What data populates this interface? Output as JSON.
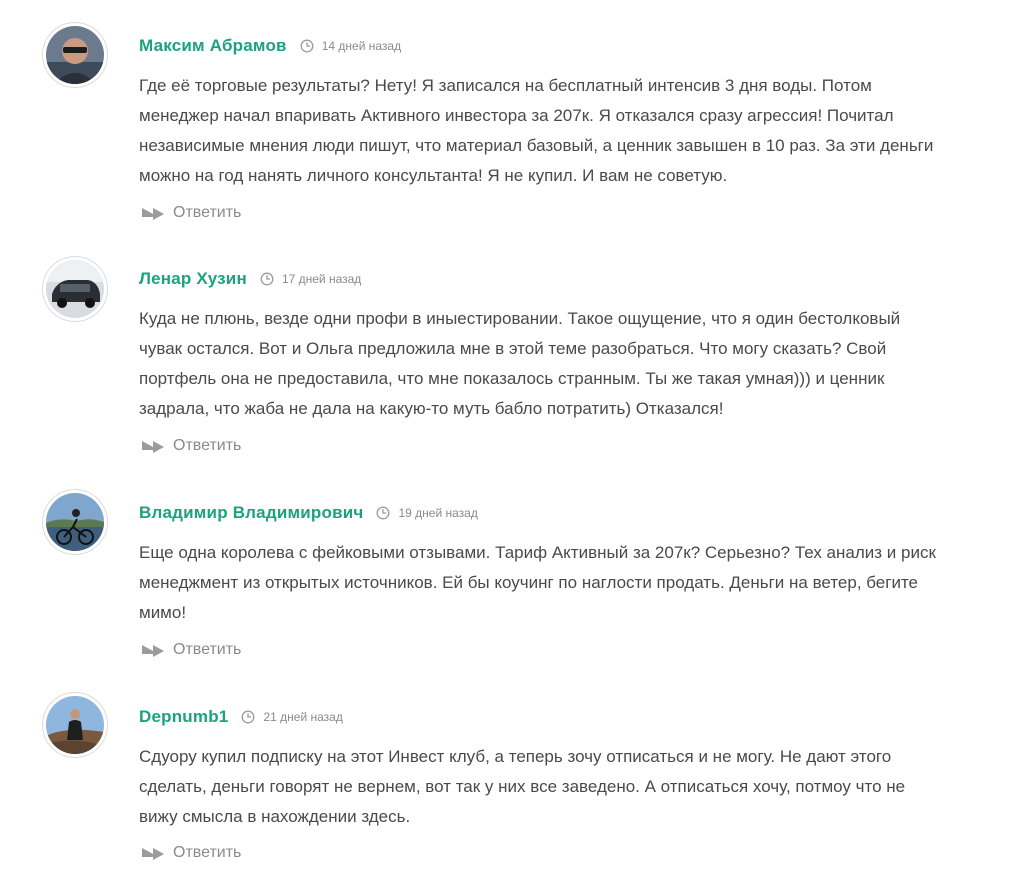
{
  "comments": [
    {
      "author": "Максим Абрамов",
      "time": "14 дней назад",
      "lines": [
        "Где её торговые результаты? Нету! Я записался на бесплатный интенсив 3 дня воды. Потом",
        "менеджер начал впаривать Активного инвестора за 207к. Я отказался сразу агрессия! Почитал",
        "независимые мнения люди пишут, что материал базовый, а ценник завышен в 10 раз. За эти деньги",
        "можно на год нанять личного консультанта! Я не купил. И вам не советую."
      ],
      "reply_label": "Ответить"
    },
    {
      "author": "Ленар Хузин",
      "time": "17 дней назад",
      "lines": [
        "Куда не плюнь, везде одни профи в иныестировании. Такое ощущение, что я один бестолковый",
        "чувак остался. Вот и Ольга предложила мне в этой теме разобраться. Что могу сказать? Свой",
        "портфель она не предоставила, что мне показалось странным. Ты же такая умная))) и ценник",
        "задрала, что жаба не дала на какую-то муть бабло потратить) Отказался!"
      ],
      "reply_label": "Ответить"
    },
    {
      "author": "Владимир Владимирович",
      "time": "19 дней назад",
      "lines": [
        "Еще одна королева с фейковыми отзывами. Тариф Активный за 207к? Серьезно? Тех анализ и риск",
        "менеджмент из открытых источников. Ей бы коучинг по наглости продать. Деньги на ветер, бегите",
        "мимо!"
      ],
      "reply_label": "Ответить"
    },
    {
      "author": "Depnumb1",
      "time": "21 дней назад",
      "lines": [
        "Сдуору купил подписку на этот Инвест клуб, а теперь зочу отписаться и не могу. Не дают этого",
        "сделать, деньги говорят не вернем, вот так у них все заведено. А отписаться хочу, потмоу что не",
        "вижу смысла в нахождении здесь."
      ],
      "reply_label": "Ответить"
    }
  ],
  "colors": {
    "author": "#1aa37e",
    "text": "#4a4a4a",
    "muted": "#8a8a8a"
  },
  "icons": {
    "time": "clock-icon",
    "reply": "reply-arrow-icon"
  }
}
